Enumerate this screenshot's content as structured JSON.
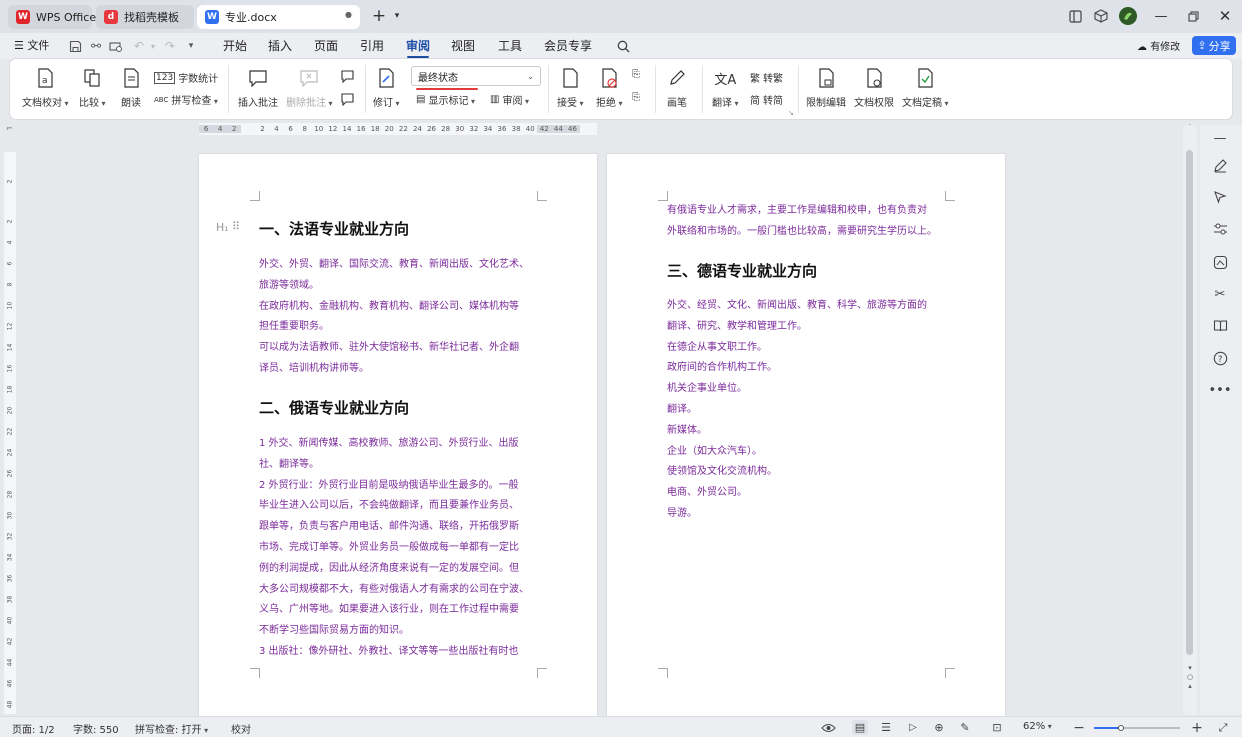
{
  "titlebar": {
    "tabs": [
      {
        "label": "WPS Office",
        "logo": "W"
      },
      {
        "label": "找稻壳模板",
        "logo": "d"
      },
      {
        "label": "专业.docx",
        "logo": "W"
      }
    ],
    "new_tab": "+",
    "colors": {
      "wps_red": "#e0262b",
      "daoke_red": "#e7383f",
      "doc_blue": "#2f6ff0"
    }
  },
  "menubar": {
    "file_label": "文件",
    "tabs": [
      "开始",
      "插入",
      "页面",
      "引用",
      "审阅",
      "视图",
      "工具",
      "会员专享"
    ],
    "active_tab": "审阅",
    "modified_label": "有修改",
    "share_label": "分享"
  },
  "ribbon": {
    "doc_check": "文档校对",
    "compare": "比较",
    "read_aloud": "朗读",
    "word_count": "字数统计",
    "spell_check": "拼写检查",
    "insert_comment": "插入批注",
    "delete_comment": "删除批注",
    "track_changes": "修订",
    "final_state": "最终状态",
    "show_markup": "显示标记",
    "review": "审阅",
    "accept": "接受",
    "reject": "拒绝",
    "pen": "画笔",
    "translate": "翻译",
    "to_traditional": "转繁",
    "to_simplified": "转简",
    "restrict_edit": "限制编辑",
    "doc_permission": "文档权限",
    "doc_finalize": "文档定稿"
  },
  "ruler": {
    "labels": [
      "6",
      "4",
      "2",
      "",
      "2",
      "4",
      "6",
      "8",
      "10",
      "12",
      "14",
      "16",
      "18",
      "20",
      "22",
      "24",
      "26",
      "28",
      "30",
      "32",
      "34",
      "36",
      "38",
      "40",
      "42",
      "44",
      "46"
    ],
    "vlabels": [
      "2",
      "2",
      "4",
      "6",
      "8",
      "10",
      "12",
      "14",
      "16",
      "18",
      "20",
      "22",
      "24",
      "26",
      "28",
      "30",
      "32",
      "34",
      "36",
      "38",
      "40",
      "42",
      "44",
      "46",
      "48"
    ]
  },
  "page1": {
    "heading1": "一、法语专业就业方向",
    "para1": [
      "外交、外贸、翻译、国际交流、教育、新闻出版、文化艺术、",
      "旅游等领域。",
      "在政府机构、金融机构、教育机构、翻译公司、媒体机构等",
      "担任重要职务。",
      "可以成为法语教师、驻外大使馆秘书、新华社记者、外企翻",
      "译员、培训机构讲师等。"
    ],
    "heading2": "二、俄语专业就业方向",
    "para2": [
      "1 外交、新闻传媒、高校教师、旅游公司、外贸行业、出版",
      "社、翻译等。",
      "2 外贸行业：外贸行业目前是吸纳俄语毕业生最多的。一般",
      "毕业生进入公司以后，不会纯做翻译，而且要兼作业务员、",
      "跟单等，负责与客户用电话、邮件沟通、联络，开拓俄罗斯",
      "市场、完成订单等。外贸业务员一般做成每一单都有一定比",
      "例的利润提成，因此从经济角度来说有一定的发展空间。但",
      "大多公司规模都不大，有些对俄语人才有需求的公司在宁波、",
      "义乌、广州等地。如果要进入该行业，则在工作过程中需要",
      "不断学习些国际贸易方面的知识。",
      "3 出版社：像外研社、外教社、译文等等一些出版社有时也"
    ]
  },
  "page2": {
    "para0": [
      "有俄语专业人才需求，主要工作是编辑和校申，也有负责对",
      "外联络和市场的。一般门槛也比较高，需要研究生学历以上。"
    ],
    "heading3": "三、德语专业就业方向",
    "para3": [
      "外交、经贸、文化、新闻出版、教育、科学、旅游等方面的",
      "翻译、研究、教学和管理工作。",
      "在德企从事文职工作。",
      "政府间的合作机构工作。",
      "机关企事业单位。",
      "翻译。",
      "新媒体。",
      "企业（如大众汽车）。",
      "使领馆及文化交流机构。",
      "电商、外贸公司。",
      "导游。"
    ]
  },
  "statusbar": {
    "page": "页面: 1/2",
    "words": "字数: 550",
    "spell": "拼写检查: 打开",
    "proof": "校对",
    "zoom": "62%"
  },
  "colors": {
    "text_purple": "#7b2a9a",
    "accent": "#1e4ea6",
    "share_blue": "#2f6ff0"
  }
}
